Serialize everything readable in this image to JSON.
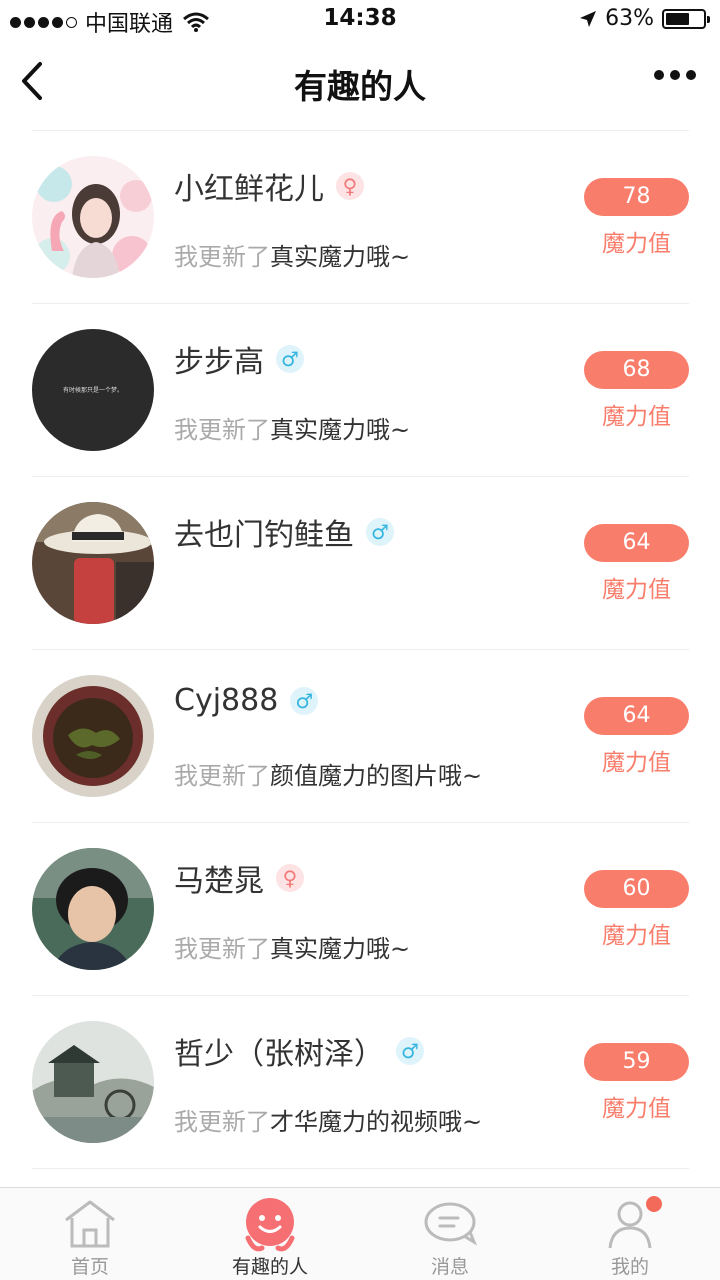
{
  "status_bar": {
    "carrier": "中国联通",
    "time": "14:38",
    "battery": "63%",
    "battery_level": 0.63
  },
  "nav": {
    "title": "有趣的人"
  },
  "users": [
    {
      "name": "小红鲜花儿",
      "gender": "female",
      "gender_symbol": "♀",
      "status_prefix": "我更新了",
      "status_text": "真实魔力哦~",
      "score": "78",
      "score_label": "魔力值"
    },
    {
      "name": "步步高",
      "gender": "male",
      "gender_symbol": "♂",
      "status_prefix": "我更新了",
      "status_text": "真实魔力哦~",
      "score": "68",
      "score_label": "魔力值",
      "avatar_text": "有时候那只是一个梦。"
    },
    {
      "name": "去也门钓鲑鱼",
      "gender": "male",
      "gender_symbol": "♂",
      "status_prefix": "",
      "status_text": "",
      "score": "64",
      "score_label": "魔力值"
    },
    {
      "name": "Cyj888",
      "gender": "male",
      "gender_symbol": "♂",
      "status_prefix": "我更新了",
      "status_text": "颜值魔力的图片哦~",
      "score": "64",
      "score_label": "魔力值"
    },
    {
      "name": "马楚晁",
      "gender": "female",
      "gender_symbol": "♀",
      "status_prefix": "我更新了",
      "status_text": "真实魔力哦~",
      "score": "60",
      "score_label": "魔力值"
    },
    {
      "name": "哲少（张树泽）",
      "gender": "male",
      "gender_symbol": "♂",
      "status_prefix": "我更新了",
      "status_text": "才华魔力的视频哦~",
      "score": "59",
      "score_label": "魔力值"
    }
  ],
  "tabs": [
    {
      "label": "首页",
      "icon": "home-icon"
    },
    {
      "label": "有趣的人",
      "icon": "people-icon",
      "active": true
    },
    {
      "label": "消息",
      "icon": "message-icon"
    },
    {
      "label": "我的",
      "icon": "profile-icon"
    }
  ],
  "colors": {
    "accent": "#f97d6b",
    "female": "#f07b7b",
    "male": "#35b6e0"
  }
}
